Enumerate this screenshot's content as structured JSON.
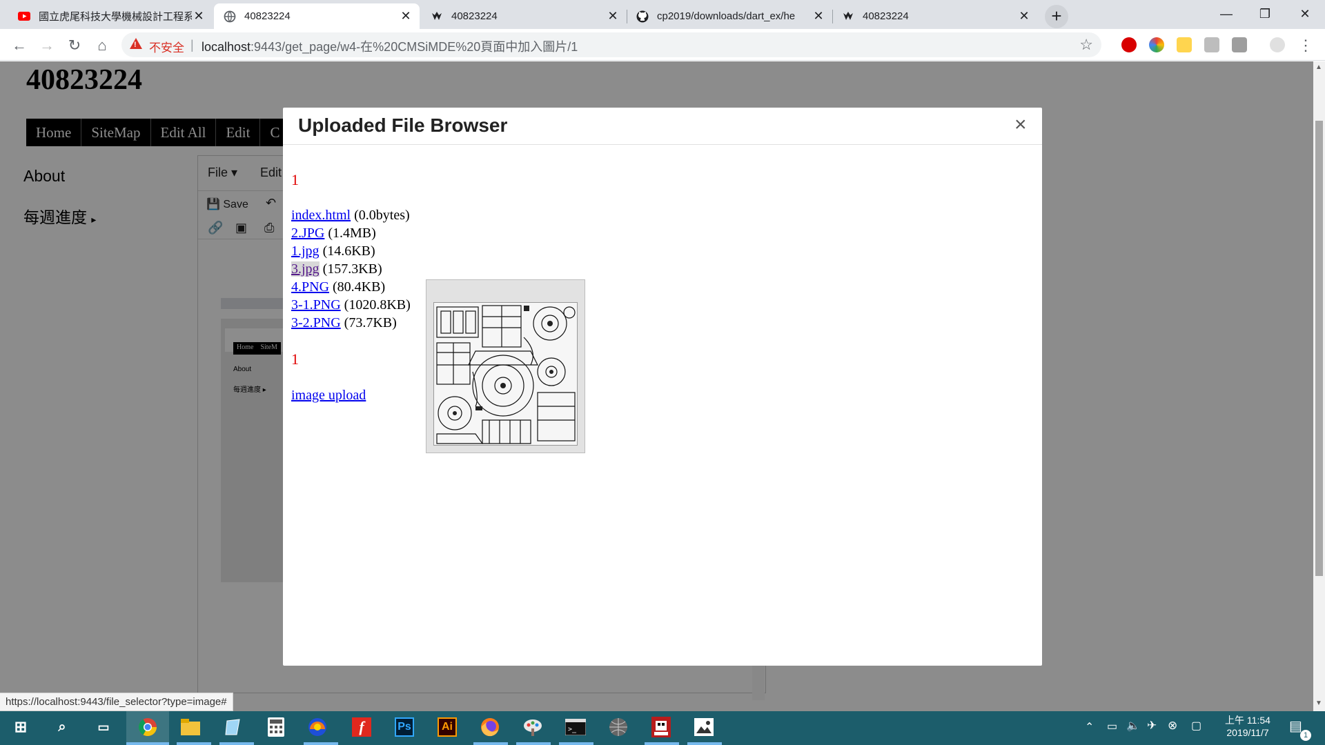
{
  "browser": {
    "tabs": [
      {
        "title": "國立虎尾科技大學機械設計工程系",
        "icon": "youtube-icon",
        "active": false
      },
      {
        "title": "40823224",
        "icon": "globe-icon",
        "active": true
      },
      {
        "title": "40823224",
        "icon": "cmsimde-icon",
        "active": false
      },
      {
        "title": "cp2019/downloads/dart_ex/he",
        "icon": "github-icon",
        "active": false
      },
      {
        "title": "40823224",
        "icon": "cmsimde-icon",
        "active": false
      }
    ],
    "insecure_label": "不安全",
    "url_host": "localhost",
    "url_rest": ":9443/get_page/w4-在%20CMSiMDE%20頁面中加入圖片/1",
    "extensions": [
      "abp-icon",
      "color-icon",
      "smart-icon",
      "ext-icon",
      "drive-icon",
      "profile-icon"
    ],
    "window_controls": {
      "minimize": "—",
      "maximize": "❐",
      "close": "✕"
    }
  },
  "site": {
    "title": "40823224",
    "nav": [
      "Home",
      "SiteMap",
      "Edit All",
      "Edit",
      "C"
    ],
    "sidebar": [
      {
        "label": "About"
      },
      {
        "label": "每週進度",
        "arrow": "▸"
      }
    ],
    "editor": {
      "menu": [
        "File",
        "Edit"
      ],
      "save_label": "Save"
    },
    "thumbnail": {
      "nav": [
        "Home",
        "SiteM"
      ],
      "sidebar": [
        "About",
        "每週進度 ▸"
      ]
    }
  },
  "modal": {
    "title": "Uploaded File Browser",
    "close_symbol": "×",
    "page_top": "1",
    "page_bottom": "1",
    "files": [
      {
        "name": "index.html",
        "size": "(0.0bytes)"
      },
      {
        "name": "2.JPG",
        "size": "(1.4MB)"
      },
      {
        "name": "1.jpg",
        "size": "(14.6KB)"
      },
      {
        "name": "3.jpg",
        "size": "(157.3KB)"
      },
      {
        "name": "4.PNG",
        "size": "(80.4KB)"
      },
      {
        "name": "3-1.PNG",
        "size": "(1020.8KB)"
      },
      {
        "name": "3-2.PNG",
        "size": "(73.7KB)"
      }
    ],
    "upload_label": "image upload"
  },
  "status_url": "https://localhost:9443/file_selector?type=image#",
  "taskbar": {
    "apps": [
      "chrome-icon",
      "file-explorer-icon",
      "notepad-icon",
      "calculator-icon",
      "ubuntu-icon",
      "flash-icon",
      "photoshop-icon",
      "illustrator-icon",
      "firefox-icon",
      "paint-icon",
      "terminal-icon",
      "sphere-icon",
      "game-icon",
      "photos-icon"
    ],
    "labels": {
      "ps": "Ps",
      "ai": "Ai",
      "flash": "f"
    },
    "time": "上午 11:54",
    "date": "2019/11/7",
    "notification_count": "1"
  },
  "colors": {
    "link": "#0000ee",
    "page_number": "#e00000",
    "taskbar": "#1c5d6b",
    "insecure": "#d93025"
  }
}
